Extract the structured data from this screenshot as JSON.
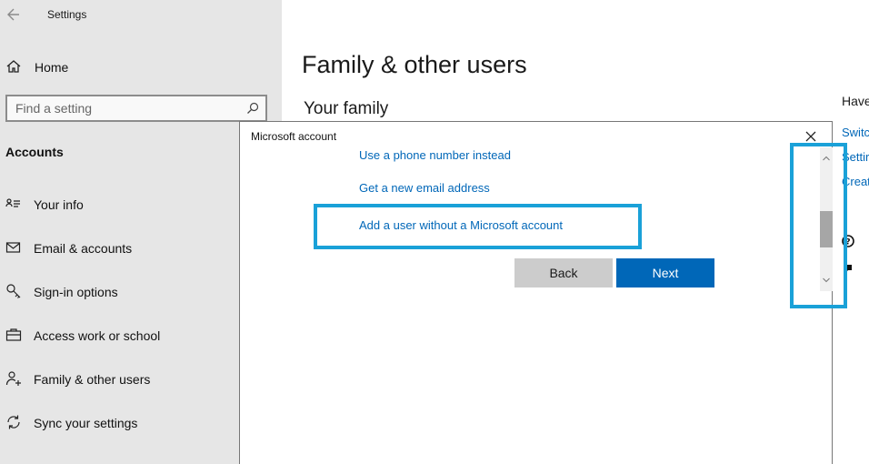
{
  "window": {
    "app_title": "Settings"
  },
  "sidebar": {
    "home_label": "Home",
    "search": {
      "placeholder": "Find a setting"
    },
    "section_heading": "Accounts",
    "items": [
      {
        "label": "Your info",
        "icon": "person-card-icon"
      },
      {
        "label": "Email & accounts",
        "icon": "mail-icon"
      },
      {
        "label": "Sign-in options",
        "icon": "key-icon"
      },
      {
        "label": "Access work or school",
        "icon": "briefcase-icon"
      },
      {
        "label": "Family & other users",
        "icon": "add-person-icon"
      },
      {
        "label": "Sync your settings",
        "icon": "sync-icon"
      }
    ]
  },
  "main": {
    "page_title": "Family & other users",
    "section_title": "Your family",
    "right_panel": {
      "heading": "Have",
      "links": [
        "Switc",
        "Settir",
        "Creat"
      ]
    }
  },
  "dialog": {
    "title": "Microsoft account",
    "links": {
      "phone": "Use a phone number instead",
      "new_email": "Get a new email address",
      "no_ms_account": "Add a user without a Microsoft account"
    },
    "buttons": {
      "back": "Back",
      "next": "Next"
    }
  },
  "colors": {
    "accent": "#0067b8",
    "highlight": "#1aa1d8",
    "sidebar_bg": "#e6e6e6"
  }
}
